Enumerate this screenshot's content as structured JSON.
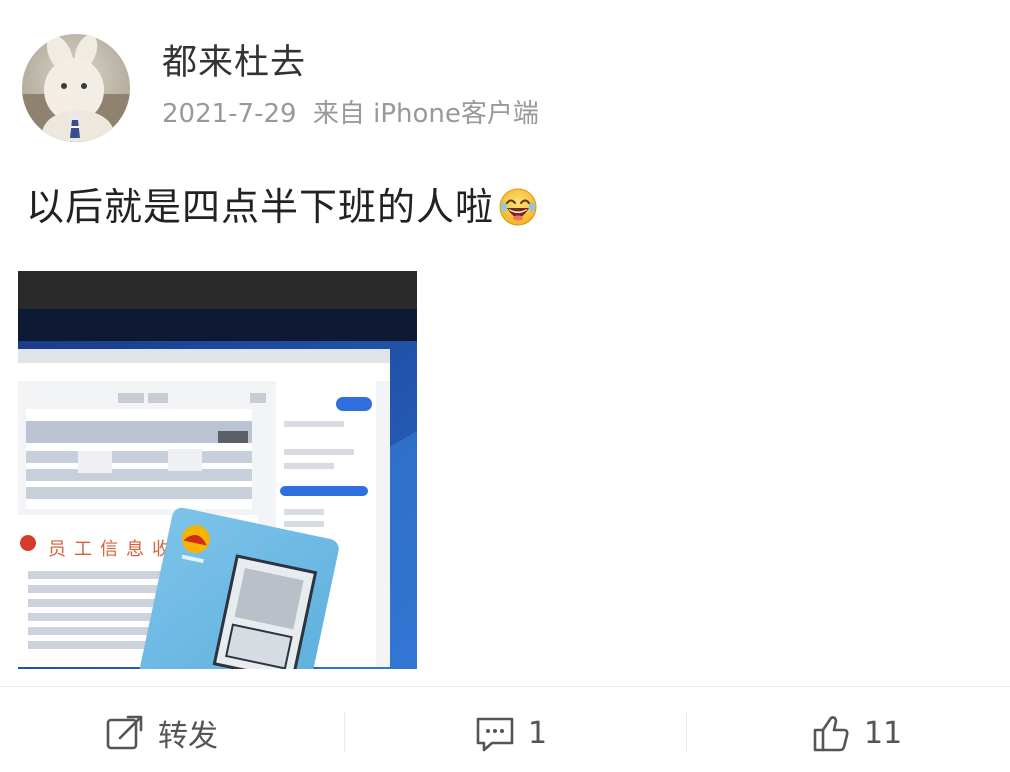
{
  "author": {
    "name": "都来杜去",
    "avatar_icon": "bunny-avatar-icon"
  },
  "meta": {
    "date": "2021-7-29",
    "source": "来自 iPhone客户端"
  },
  "post": {
    "text": "以后就是四点半下班的人啦",
    "emoji": "laughing-face-icon"
  },
  "actions": {
    "repost_label": "转发",
    "comment_count": "1",
    "like_count": "11"
  },
  "colors": {
    "accent": "#1677ff",
    "text": "#222222",
    "muted": "#999999"
  }
}
